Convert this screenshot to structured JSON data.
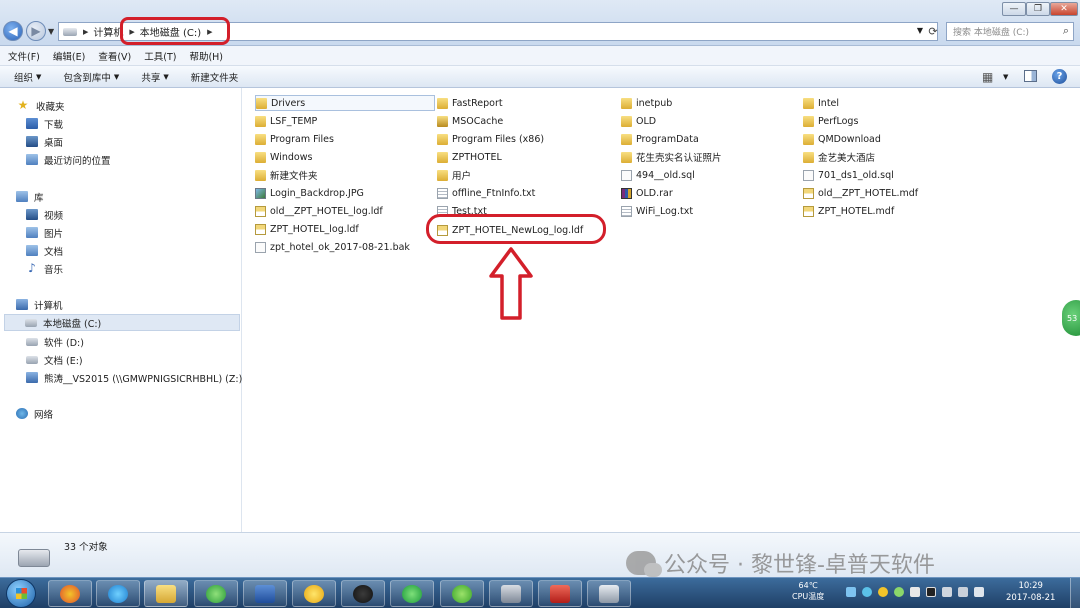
{
  "window": {
    "breadcrumbs": [
      "计算机",
      "本地磁盘 (C:)"
    ],
    "search_placeholder": "搜索 本地磁盘 (C:)"
  },
  "menubar": [
    "文件(F)",
    "编辑(E)",
    "查看(V)",
    "工具(T)",
    "帮助(H)"
  ],
  "commandbar": {
    "organize": "组织",
    "include_library": "包含到库中",
    "share": "共享",
    "new_folder": "新建文件夹"
  },
  "nav": {
    "favorites": {
      "label": "收藏夹",
      "items": [
        "下载",
        "桌面",
        "最近访问的位置"
      ]
    },
    "libraries": {
      "label": "库",
      "items": [
        "视频",
        "图片",
        "文档",
        "音乐"
      ]
    },
    "computer": {
      "label": "计算机",
      "items": [
        "本地磁盘 (C:)",
        "软件 (D:)",
        "文档 (E:)",
        "熊涛__VS2015 (\\\\GMWPNIGSICRHBHL) (Z:)"
      ]
    },
    "network": {
      "label": "网络"
    }
  },
  "files": {
    "col1": [
      "Drivers",
      "LSF_TEMP",
      "Program Files",
      "Windows",
      "新建文件夹",
      "Login_Backdrop.JPG",
      "old__ZPT_HOTEL_log.ldf",
      "ZPT_HOTEL_log.ldf",
      "zpt_hotel_ok_2017-08-21.bak"
    ],
    "col2": [
      "FastReport",
      "MSOCache",
      "Program Files (x86)",
      "ZPTHOTEL",
      "用户",
      "offline_FtnInfo.txt",
      "Test.txt",
      "ZPT_HOTEL_NewLog_log.ldf"
    ],
    "col3": [
      "inetpub",
      "OLD",
      "ProgramData",
      "花生壳实名认证照片",
      "494__old.sql",
      "OLD.rar",
      "WiFi_Log.txt"
    ],
    "col4": [
      "Intel",
      "PerfLogs",
      "QMDownload",
      "金艺美大酒店",
      "701_ds1_old.sql",
      "old__ZPT_HOTEL.mdf",
      "ZPT_HOTEL.mdf"
    ]
  },
  "status": {
    "count": "33 个对象",
    "watermark": "公众号 · 黎世锋-卓普天软件"
  },
  "float_badge": "53",
  "tray": {
    "cpu_value": "64℃",
    "cpu_label": "CPU温度",
    "time": "10:29",
    "date": "2017-08-21"
  },
  "colors": {
    "highlight_red": "#d31f2a",
    "folder_yellow": "#e2b53b",
    "taskbar_blue": "#1f3f66"
  }
}
